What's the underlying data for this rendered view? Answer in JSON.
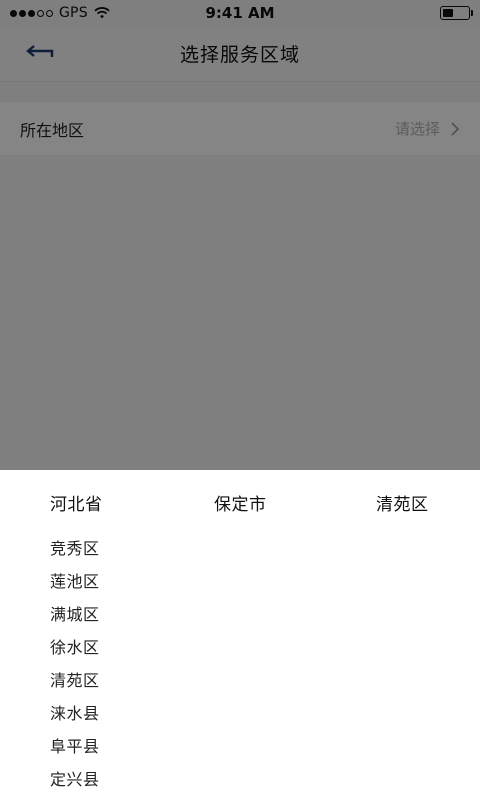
{
  "status_bar": {
    "carrier": "GPS",
    "time": "9:41 AM",
    "signal_dots_filled": 3,
    "signal_dots_total": 5,
    "battery_level": 0.4
  },
  "nav": {
    "title": "选择服务区域",
    "back_icon": "back-arrow-icon"
  },
  "region": {
    "label": "所在地区",
    "placeholder": "请选择",
    "chevron_icon": "chevron-right-icon"
  },
  "picker": {
    "province": "河北省",
    "city": "保定市",
    "district": "清苑区",
    "items": [
      "竞秀区",
      "莲池区",
      "满城区",
      "徐水区",
      "清苑区",
      "涞水县",
      "阜平县",
      "定兴县"
    ]
  },
  "colors": {
    "overlay": "#7a7a7a",
    "nav_background": "#f7f7f7",
    "back_icon": "#1b3b6f",
    "placeholder_text": "#b0b0b0"
  }
}
